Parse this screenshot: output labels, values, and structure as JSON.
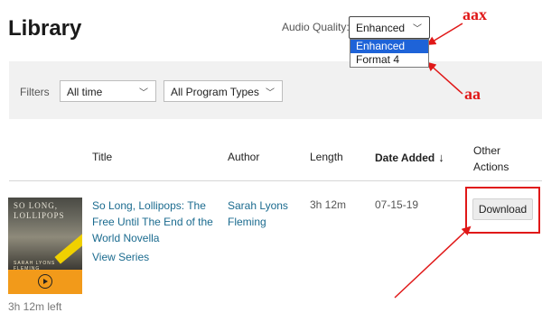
{
  "page": {
    "title": "Library"
  },
  "audio_quality": {
    "label": "Audio Quality:",
    "selected": "Enhanced",
    "options": [
      "Enhanced",
      "Format 4"
    ]
  },
  "filters": {
    "label": "Filters",
    "time": "All time",
    "program_type": "All Program Types"
  },
  "table": {
    "headers": {
      "title": "Title",
      "author": "Author",
      "length": "Length",
      "date_added": "Date Added",
      "sort_arrow": "↓",
      "other_actions_line1": "Other",
      "other_actions_line2": "Actions"
    },
    "rows": [
      {
        "cover_title_1": "SO LONG,",
        "cover_title_2": "LOLLIPOPS",
        "cover_author": "SARAH LYONS FLEMING",
        "time_left": "3h 12m left",
        "title": "So Long, Lollipops: The Free Until The End of the World Novella",
        "view_series": "View Series",
        "author": "Sarah Lyons Fleming",
        "length": "3h 12m",
        "date_added": "07-15-19",
        "action": "Download"
      }
    ]
  },
  "annotations": {
    "label_aax": "aax",
    "label_aa": "aa",
    "color": "#e01818"
  },
  "colors": {
    "link": "#1b6b8f",
    "selected_option": "#1e63d8",
    "play_bar": "#f29a1a"
  }
}
